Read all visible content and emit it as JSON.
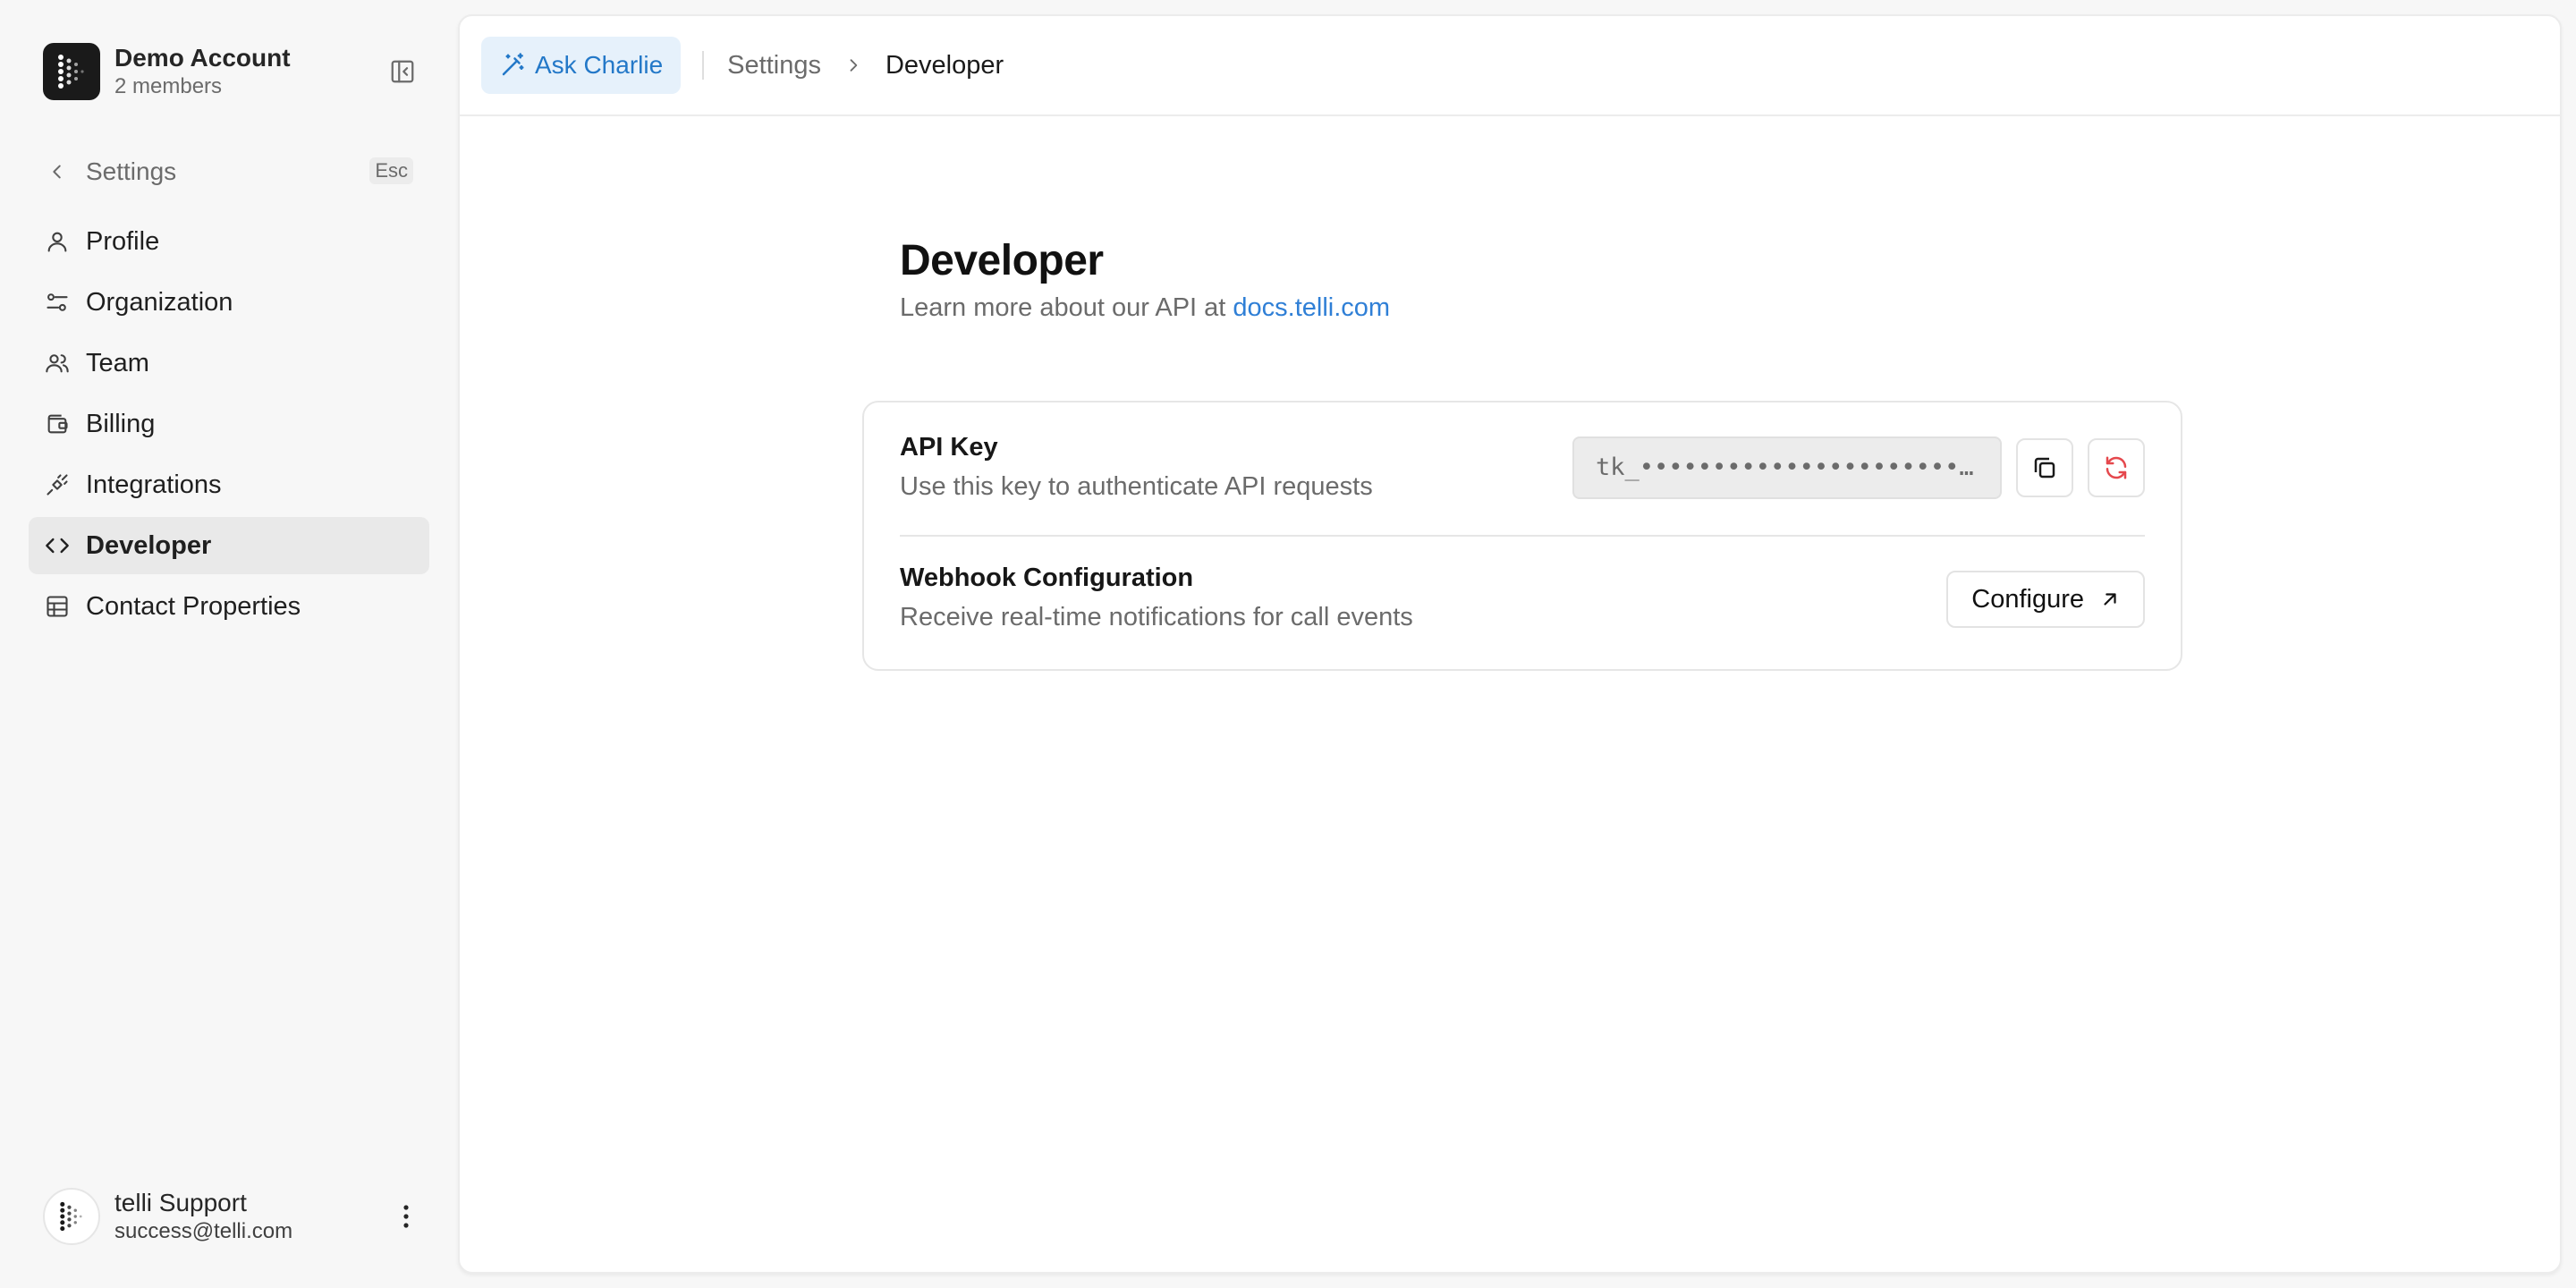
{
  "sidebar": {
    "account": {
      "name": "Demo Account",
      "members": "2 members"
    },
    "back": {
      "label": "Settings",
      "shortcut": "Esc"
    },
    "items": [
      {
        "label": "Profile",
        "icon": "user-icon",
        "active": false
      },
      {
        "label": "Organization",
        "icon": "sliders-icon",
        "active": false
      },
      {
        "label": "Team",
        "icon": "users-icon",
        "active": false
      },
      {
        "label": "Billing",
        "icon": "wallet-icon",
        "active": false
      },
      {
        "label": "Integrations",
        "icon": "plug-icon",
        "active": false
      },
      {
        "label": "Developer",
        "icon": "code-icon",
        "active": true
      },
      {
        "label": "Contact Properties",
        "icon": "table-icon",
        "active": false
      }
    ],
    "user": {
      "name": "telli Support",
      "email": "success@telli.com"
    }
  },
  "topbar": {
    "ask_label": "Ask Charlie",
    "breadcrumb": {
      "parent": "Settings",
      "current": "Developer"
    }
  },
  "page": {
    "title": "Developer",
    "subtitle_prefix": "Learn more about our API at",
    "docs_link": "docs.telli.com"
  },
  "api_key": {
    "title": "API Key",
    "description": "Use this key to authenticate API requests",
    "masked_value": "tk_••••••••••••••••••••••••••••••"
  },
  "webhook": {
    "title": "Webhook Configuration",
    "description": "Receive real-time notifications for call events",
    "button_label": "Configure"
  },
  "colors": {
    "accent_blue": "#2378c8",
    "link_blue": "#2f7fd6",
    "regen_red": "#e5484d",
    "active_nav_bg": "#e9e9e9"
  }
}
